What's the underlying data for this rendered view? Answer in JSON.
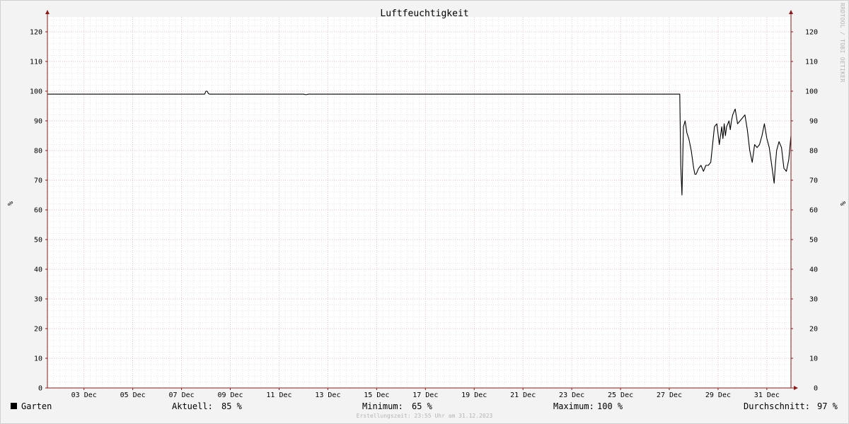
{
  "watermark": "RRDTOOL / TOBI OETIKER",
  "credit": "Erstellungszeit: 23:55 Uhr am 31.12.2023",
  "legend": {
    "series_name": "Garten",
    "aktuell_label": "Aktuell:",
    "aktuell_value": "85 %",
    "minimum_label": "Minimum:",
    "minimum_value": "65 %",
    "maximum_label": "Maximum:",
    "maximum_value": "100 %",
    "avg_label": "Durchschnitt:",
    "avg_value": "97 %"
  },
  "colors": {
    "background": "#f3f3f3",
    "plot": "#ffffff",
    "minor_grid": "#d8d8d8",
    "major_grid": "#f0a6a6",
    "axis": "#8b1a1a",
    "line": "#000000"
  },
  "chart_data": {
    "type": "line",
    "title": "Luftfeuchtigkeit",
    "ylabel": "%",
    "ylabel_right": "%",
    "ylim": [
      0,
      125
    ],
    "xlim": [
      1.5,
      31.99
    ],
    "y_ticks": [
      0,
      10,
      20,
      30,
      40,
      50,
      60,
      70,
      80,
      90,
      100,
      110,
      120
    ],
    "y_tick_labels": [
      "0",
      "10",
      "20",
      "30",
      "40",
      "50",
      "60",
      "70",
      "80",
      "90",
      "100",
      "110",
      "120"
    ],
    "x_ticks": [
      3,
      5,
      7,
      9,
      11,
      13,
      15,
      17,
      19,
      21,
      23,
      25,
      27,
      29,
      31
    ],
    "x_tick_labels": [
      "03 Dec",
      "05 Dec",
      "07 Dec",
      "09 Dec",
      "11 Dec",
      "13 Dec",
      "15 Dec",
      "17 Dec",
      "19 Dec",
      "21 Dec",
      "23 Dec",
      "25 Dec",
      "27 Dec",
      "29 Dec",
      "31 Dec"
    ],
    "grid": true,
    "series": [
      {
        "name": "Garten",
        "x": [
          1.5,
          7.95,
          8.0,
          8.05,
          8.1,
          8.15,
          12.0,
          12.1,
          12.2,
          27.43,
          27.47,
          27.52,
          27.58,
          27.65,
          27.72,
          27.8,
          27.9,
          28.0,
          28.05,
          28.1,
          28.2,
          28.3,
          28.4,
          28.5,
          28.6,
          28.7,
          28.85,
          28.95,
          29.05,
          29.15,
          29.2,
          29.25,
          29.3,
          29.35,
          29.45,
          29.5,
          29.55,
          29.6,
          29.7,
          29.8,
          29.9,
          30.0,
          30.1,
          30.2,
          30.3,
          30.4,
          30.5,
          30.6,
          30.7,
          30.8,
          30.9,
          31.0,
          31.1,
          31.2,
          31.3,
          31.35,
          31.4,
          31.5,
          31.6,
          31.7,
          31.8,
          31.9,
          31.99
        ],
        "y": [
          99,
          99,
          100,
          100,
          99.2,
          99,
          99,
          98.8,
          99,
          99,
          75,
          65,
          88,
          90,
          86,
          84,
          80,
          74,
          72,
          72,
          74,
          75,
          73,
          75,
          75,
          76,
          88,
          89,
          82,
          88,
          84,
          89,
          85,
          88,
          90,
          87,
          90,
          92,
          94,
          89,
          90,
          91,
          92,
          87,
          80,
          76,
          82,
          81,
          82,
          85,
          89,
          84,
          81,
          75,
          69,
          75,
          80,
          83,
          81,
          74,
          73,
          77,
          85
        ]
      }
    ]
  }
}
